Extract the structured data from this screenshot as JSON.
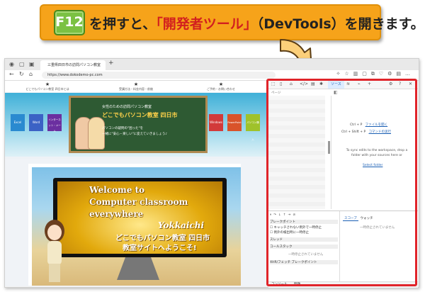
{
  "callout": {
    "key": "F12",
    "text_1": "を押すと、",
    "text_highlight": "「開発者ツール」",
    "text_2": "（DevTools）を開きます。"
  },
  "browser": {
    "tab_title": "三重県四日市の訪問パソコン教室",
    "url": "https://www.dokodemo-pc.com",
    "tab_plus": "+"
  },
  "site": {
    "nav_items": [
      "どこでもパソコン教室 四日市とは",
      "受講方法・料金内容・前後",
      "ご予約・お問い合わせ"
    ],
    "hero_buttons": [
      "Excel",
      "Word",
      "インターネット・メール",
      "Windows",
      "PowerPoint",
      "パソコン購入"
    ],
    "board_line1": "女性のための訪問パソコン教室",
    "board_line2": "どこでもパソコン教室 四日市",
    "board_line3": "パソコンの疑問の\"困った\"を",
    "board_line4": "一緒に\"安心・楽しい\"に変えていきましょう♪",
    "welcome": "Welcome to\nComputer classroom\neverywhere",
    "welcome_city": "Yokkaichi",
    "jp_line1": "どこでもパソコン教室 四日市",
    "jp_line2": "教室サイトへようこそ!"
  },
  "devtools": {
    "tab_sources": "ソース",
    "sub_label": "ページ",
    "shortcut1_keys": "Ctrl + P",
    "shortcut1_link": "ファイルを開く",
    "shortcut2_keys": "Ctrl + Shift + P",
    "shortcut2_link": "コマンドの実行",
    "sync_text": "To sync edits to the workspace, drop a folder with your sources here or",
    "select_folder": "Select folder",
    "bottom_left": {
      "breakpoints": "ブレークポイント",
      "cb1": "キャッチされない例外で一時停止",
      "cb2": "例外の検出時に一時停止",
      "threads": "スレッド",
      "callstack": "コールスタック",
      "not_paused": "一時停止されていません",
      "xhr": "XHR/フェッチ ブレークポイント"
    },
    "bottom_right": {
      "scope": "スコープ",
      "watch": "ウォッチ",
      "not_paused": "一時停止されていません"
    },
    "console_tab": "コンソール",
    "issues_tab": "問題"
  }
}
